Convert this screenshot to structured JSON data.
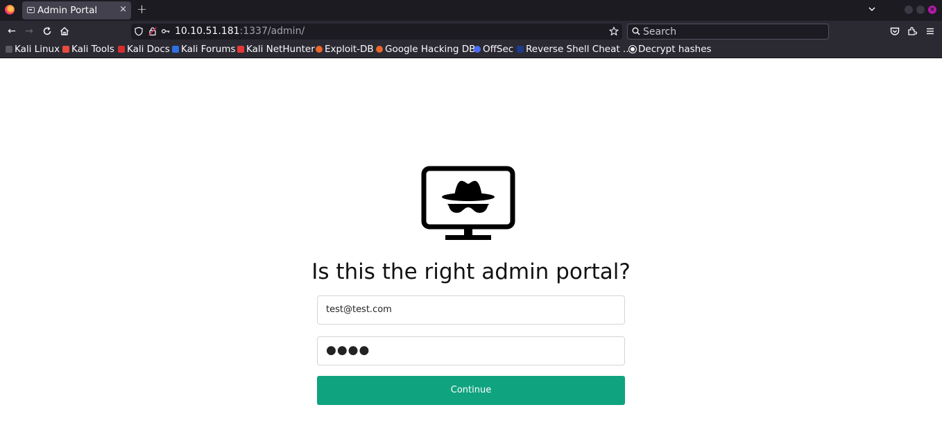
{
  "browser": {
    "tab": {
      "title": "Admin Portal",
      "close_glyph": "×"
    },
    "new_tab_glyph": "+",
    "url": {
      "host": "10.10.51.181",
      "rest": ":1337/admin/"
    },
    "search": {
      "placeholder": "Search"
    },
    "bookmarks": [
      {
        "label": "Kali Linux",
        "color": "#367bf0"
      },
      {
        "label": "Kali Tools",
        "color": "#e84c3d"
      },
      {
        "label": "Kali Docs",
        "color": "#d32f2f"
      },
      {
        "label": "Kali Forums",
        "color": "#2f6fde"
      },
      {
        "label": "Kali NetHunter",
        "color": "#e53935"
      },
      {
        "label": "Exploit-DB",
        "color": "#e8672a"
      },
      {
        "label": "Google Hacking DB",
        "color": "#e8672a"
      },
      {
        "label": "OffSec",
        "color": "#4a6cf7"
      },
      {
        "label": "Reverse Shell Cheat ...",
        "color": "#1e3a8a"
      },
      {
        "label": "Decrypt hashes",
        "color": "#ffffff"
      }
    ]
  },
  "page": {
    "headline": "Is this the right admin portal?",
    "email_value": "test@test.com",
    "password_mask": "●●●●",
    "continue_label": "Continue",
    "accent_color": "#10a37f"
  }
}
